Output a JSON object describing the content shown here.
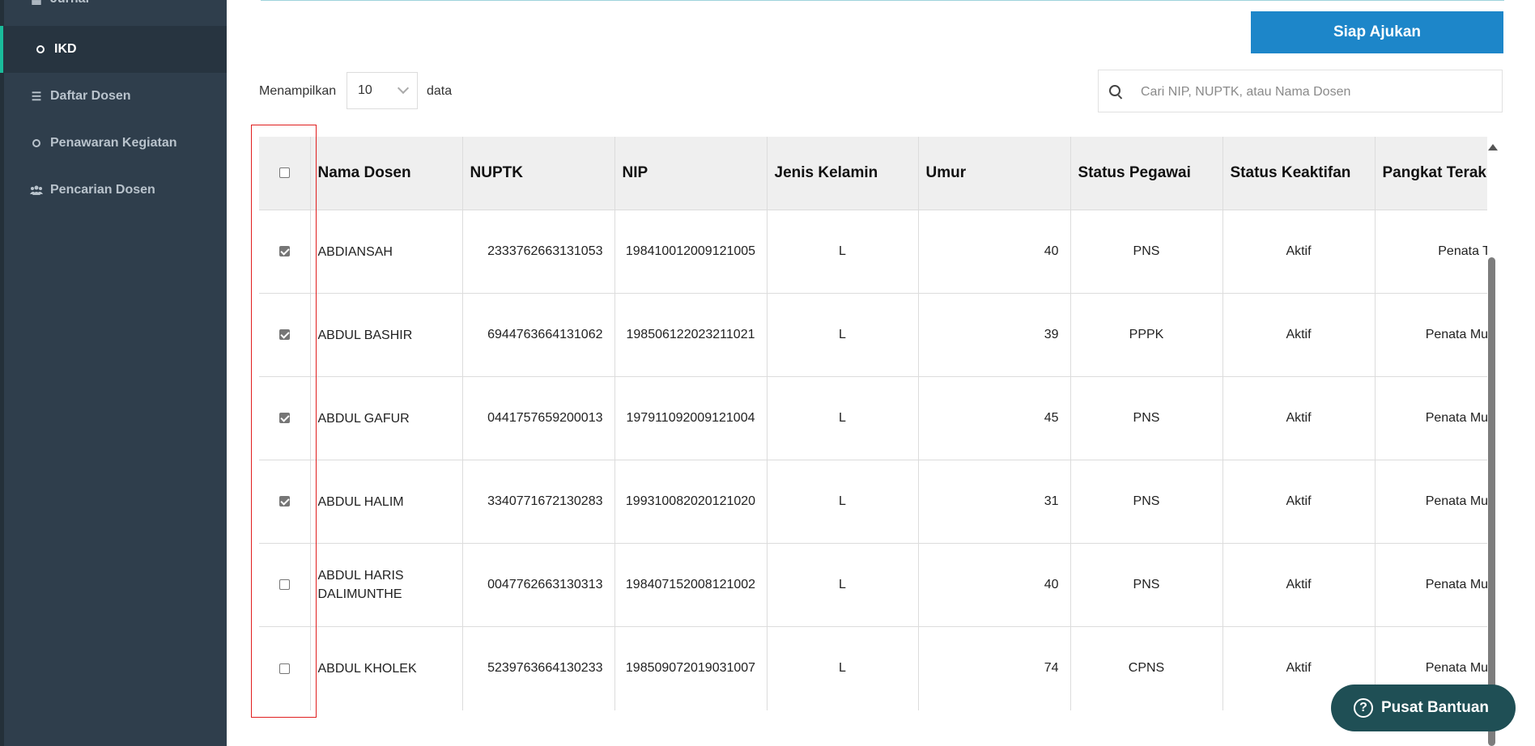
{
  "sidebar": {
    "items": [
      {
        "label": "Jurnal",
        "icon": "book-icon"
      },
      {
        "label": "IKD",
        "icon": "circle-icon",
        "active": true
      },
      {
        "label": "Daftar Dosen",
        "icon": "list-icon"
      },
      {
        "label": "Penawaran Kegiatan",
        "icon": "circle-icon"
      },
      {
        "label": "Pencarian Dosen",
        "icon": "users-icon"
      }
    ]
  },
  "toolbar": {
    "submit_label": "Siap Ajukan",
    "show_prefix": "Menampilkan",
    "page_size": "10",
    "show_suffix": "data",
    "search_placeholder": "Cari NIP, NUPTK, atau Nama Dosen"
  },
  "table": {
    "headers": [
      "Nama Dosen",
      "NUPTK",
      "NIP",
      "Jenis Kelamin",
      "Umur",
      "Status Pegawai",
      "Status Keaktifan",
      "Pangkat Terakhir"
    ],
    "rows": [
      {
        "checked": true,
        "name": "ABDIANSAH",
        "nuptk": "2333762663131053",
        "nip": "198410012009121005",
        "gender": "L",
        "age": "40",
        "status": "PNS",
        "active": "Aktif",
        "rank": "Penata Tk. I"
      },
      {
        "checked": true,
        "name": "ABDUL BASHIR",
        "nuptk": "6944763664131062",
        "nip": "198506122023211021",
        "gender": "L",
        "age": "39",
        "status": "PPPK",
        "active": "Aktif",
        "rank": "Penata Muda Tk"
      },
      {
        "checked": true,
        "name": "ABDUL GAFUR",
        "nuptk": "0441757659200013",
        "nip": "197911092009121004",
        "gender": "L",
        "age": "45",
        "status": "PNS",
        "active": "Aktif",
        "rank": "Penata Muda Tk"
      },
      {
        "checked": true,
        "name": "ABDUL HALIM",
        "nuptk": "3340771672130283",
        "nip": "199310082020121020",
        "gender": "L",
        "age": "31",
        "status": "PNS",
        "active": "Aktif",
        "rank": "Penata Muda Tk"
      },
      {
        "checked": false,
        "name": "ABDUL HARIS DALIMUNTHE",
        "nuptk": "0047762663130313",
        "nip": "198407152008121002",
        "gender": "L",
        "age": "40",
        "status": "PNS",
        "active": "Aktif",
        "rank": "Penata Muda Tk"
      },
      {
        "checked": false,
        "name": "ABDUL KHOLEK",
        "nuptk": "5239763664130233",
        "nip": "198509072019031007",
        "gender": "L",
        "age": "74",
        "status": "CPNS",
        "active": "Aktif",
        "rank": "Penata Muda Tk"
      }
    ]
  },
  "help": {
    "label": "Pusat Bantuan"
  },
  "colors": {
    "sidebar": "#2f3e4c",
    "accent": "#1d86c9",
    "active_marker": "#1abc9c",
    "help_bg": "#1f4f55",
    "highlight": "#e01e1e"
  }
}
